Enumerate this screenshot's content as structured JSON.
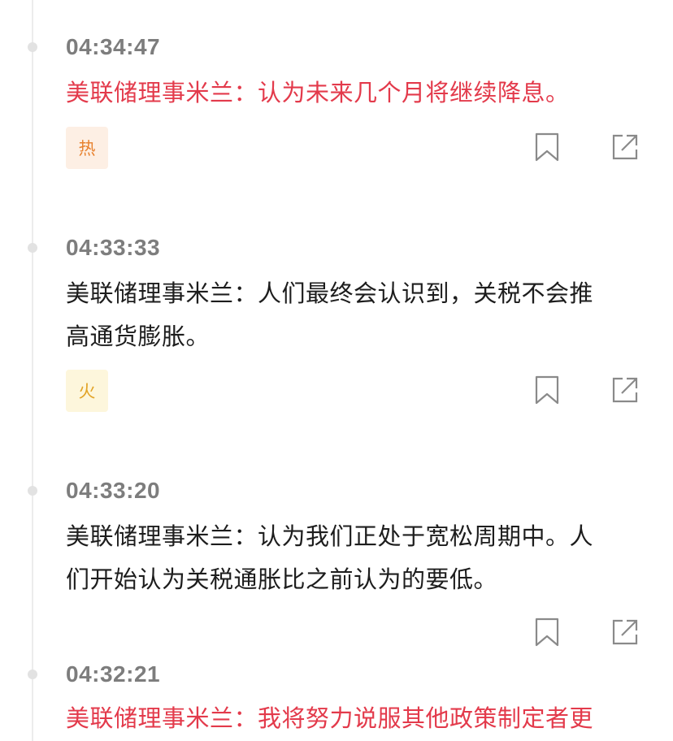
{
  "feed": {
    "items": [
      {
        "time": "04:34:47",
        "line1": "美联储理事米兰：认为未来几个月将继续降息。",
        "line2": "",
        "highlight": true,
        "tag": "热",
        "tag_style": "hot"
      },
      {
        "time": "04:33:33",
        "line1": "美联储理事米兰：人们最终会认识到，关税不会推",
        "line2": "高通货膨胀。",
        "highlight": false,
        "tag": "火",
        "tag_style": "fire"
      },
      {
        "time": "04:33:20",
        "line1": "美联储理事米兰：认为我们正处于宽松周期中。人",
        "line2": "们开始认为关税通胀比之前认为的要低。",
        "highlight": false,
        "tag": "",
        "tag_style": ""
      },
      {
        "time": "04:32:21",
        "line1": "美联储理事米兰：我将努力说服其他政策制定者更",
        "line2": "",
        "highlight": true,
        "tag": "",
        "tag_style": ""
      }
    ]
  },
  "icons": {
    "bookmark": "bookmark-icon",
    "share": "share-icon"
  },
  "colors": {
    "highlight_text": "#e33a4b",
    "normal_text": "#1d1d1d",
    "time_text": "#7d7d7d",
    "hot_tag_bg": "#fdefe4",
    "hot_tag_text": "#e8822f",
    "fire_tag_bg": "#fdf6dc",
    "fire_tag_text": "#e2a326"
  }
}
